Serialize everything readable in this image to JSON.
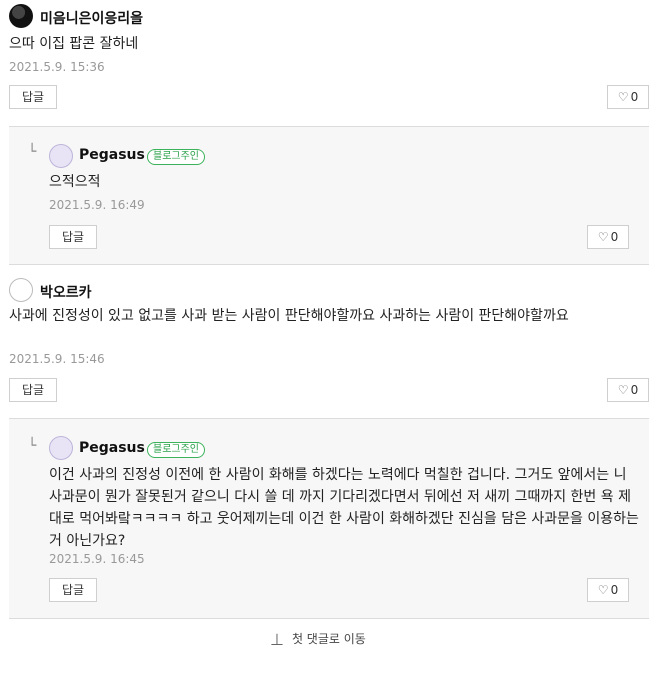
{
  "comments": [
    {
      "nick": "미음니은이응리을",
      "text": "으따 이집 팝콘 잘하네",
      "date": "2021.5.9. 15:36",
      "reply_label": "답글",
      "likes": "0",
      "reply": {
        "nick": "Pegasus",
        "badge": "블로그주인",
        "text": "으적으적",
        "date": "2021.5.9. 16:49",
        "reply_label": "답글",
        "likes": "0"
      }
    },
    {
      "nick": "박오르카",
      "text": "사과에 진정성이 있고 없고를 사과 받는 사람이 판단해야할까요 사과하는 사람이 판단해야할까요",
      "date": "2021.5.9. 15:46",
      "reply_label": "답글",
      "likes": "0",
      "reply": {
        "nick": "Pegasus",
        "badge": "블로그주인",
        "text": "이건 사과의 진정성 이전에 한 사람이 화해를 하겠다는 노력에다 먹칠한 겁니다. 그거도 앞에서는 니 사과문이 뭔가 잘못된거 같으니 다시 쓸 데 까지 기다리겠다면서 뒤에선 저 새끼 그때까지 한번 욕 제대로 먹어봐랔ㅋㅋㅋㅋ 하고 웃어제끼는데 이건 한 사람이 화해하겠단 진심을 담은 사과문을 이용하는 거 아닌가요?",
        "date": "2021.5.9. 16:45",
        "reply_label": "답글",
        "likes": "0"
      }
    }
  ],
  "footer": {
    "go_first": "첫 댓글로 이동"
  }
}
